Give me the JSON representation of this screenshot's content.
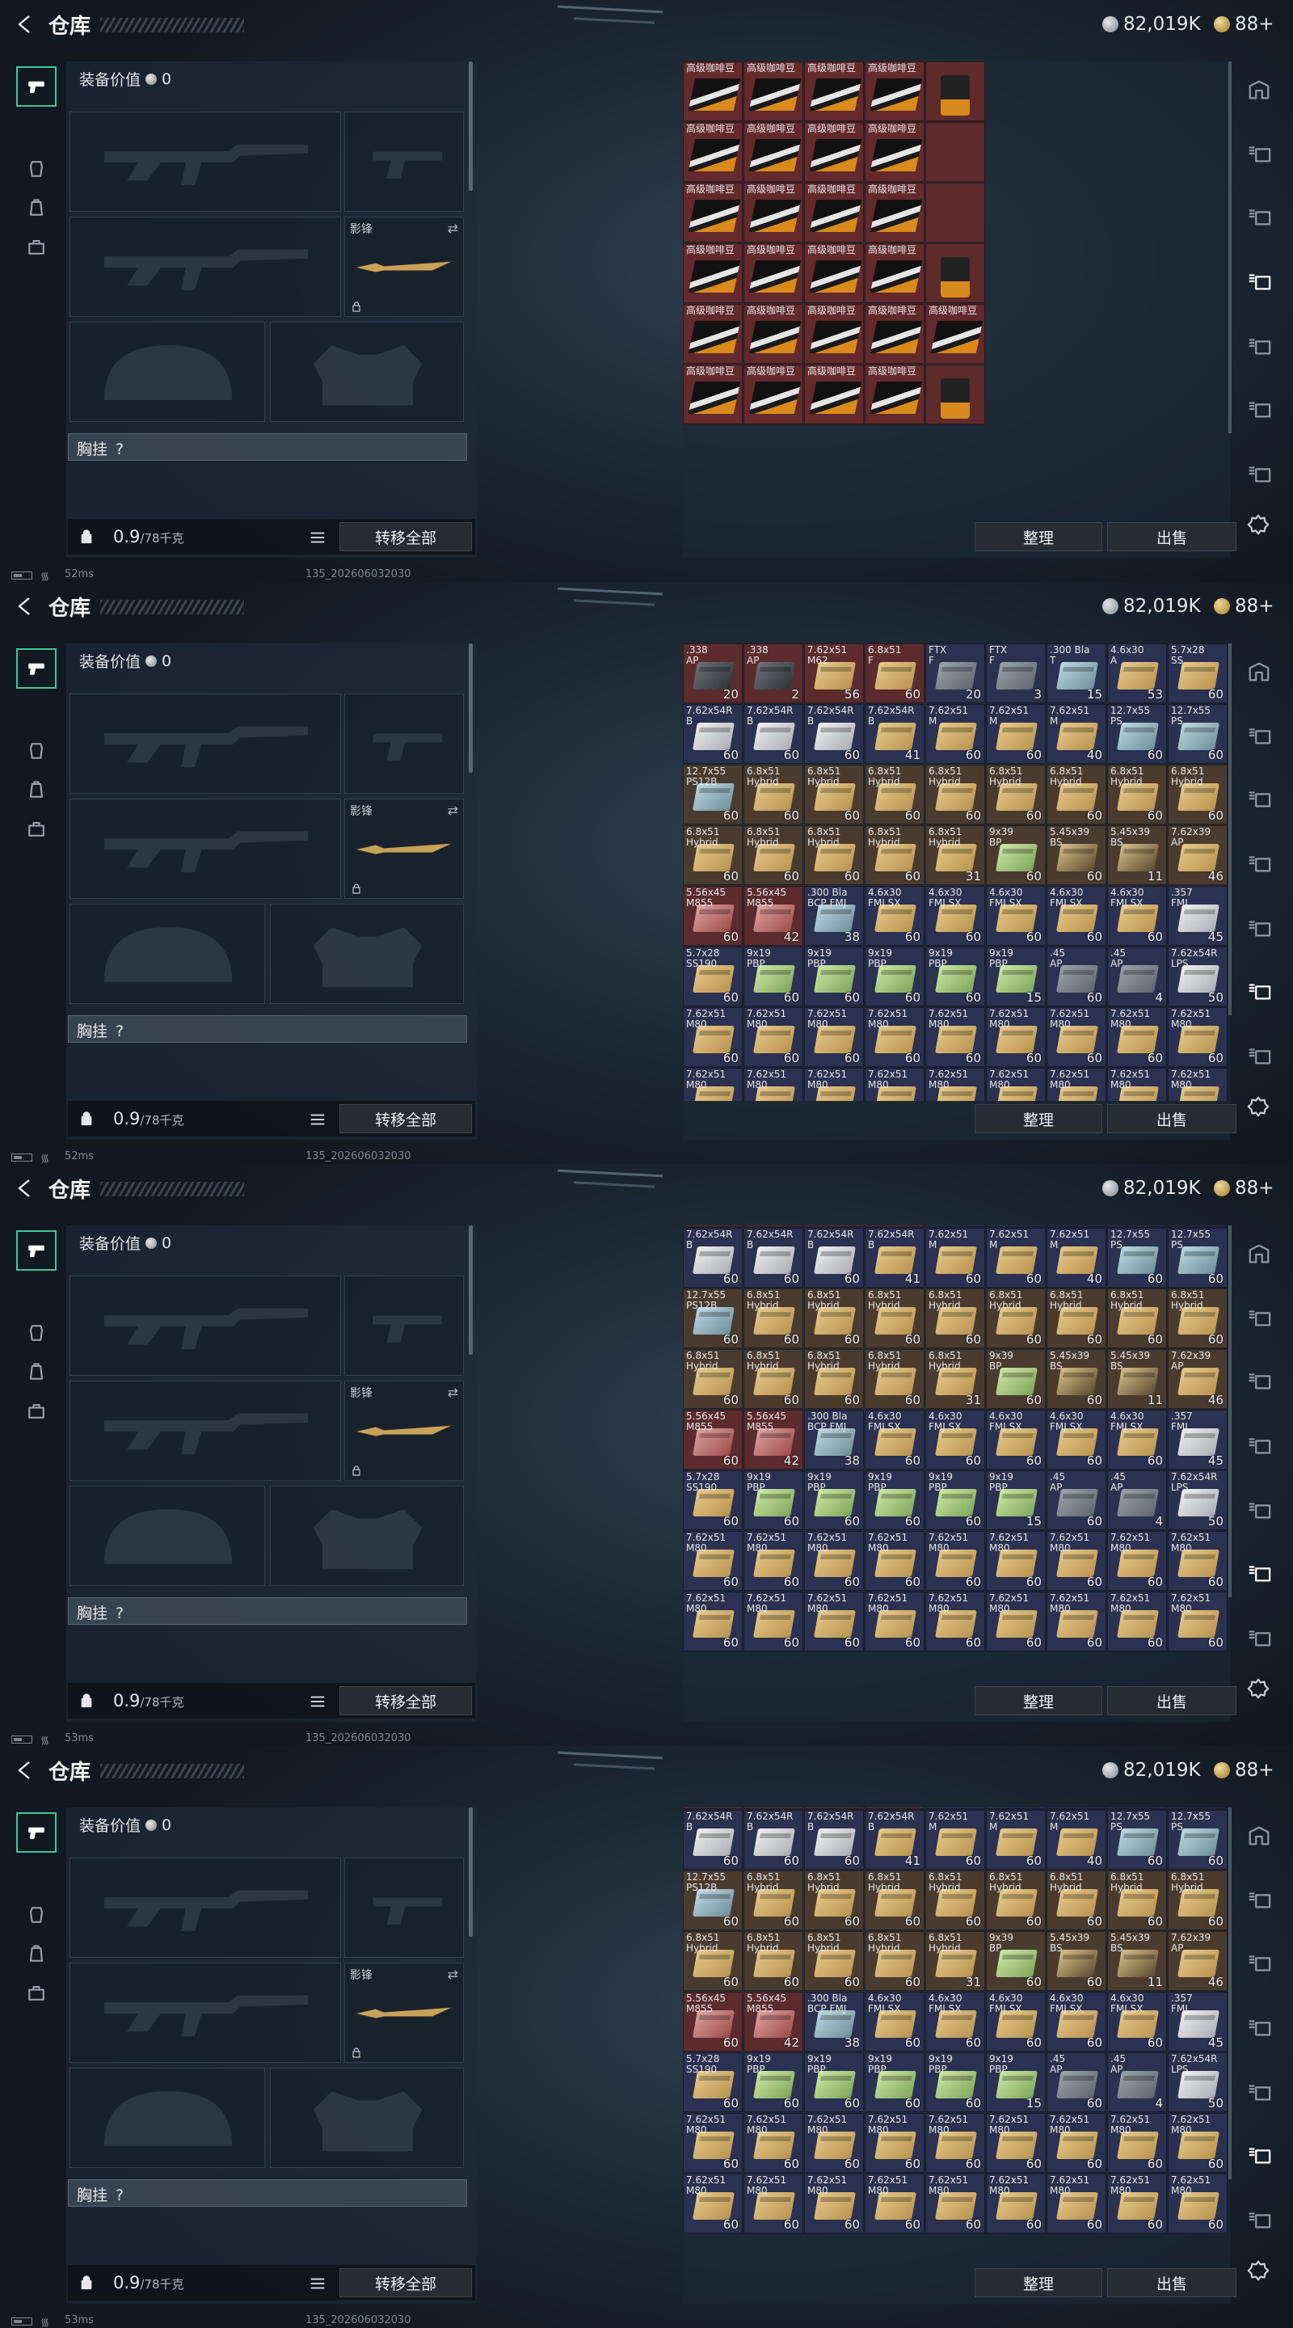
{
  "screens": [
    {
      "title": "仓库",
      "silver": "82,019K",
      "gold": "88+",
      "equip_value_label": "装备价值",
      "equip_value": "0",
      "knife_name": "影锋",
      "chest_label": "胸挂",
      "chest_help": "?",
      "weight_value": "0.9",
      "weight_max": "/78千克",
      "transfer_label": "转移全部",
      "sort_label": "整理",
      "sell_label": "出售",
      "ping": "52ms",
      "build": "135_202606032030",
      "view": "coffee"
    },
    {
      "title": "仓库",
      "silver": "82,019K",
      "gold": "88+",
      "equip_value_label": "装备价值",
      "equip_value": "0",
      "knife_name": "影锋",
      "chest_label": "胸挂",
      "chest_help": "?",
      "weight_value": "0.9",
      "weight_max": "/78千克",
      "transfer_label": "转移全部",
      "sort_label": "整理",
      "sell_label": "出售",
      "ping": "52ms",
      "build": "135_202606032030",
      "view": "ammo",
      "scroll": 0
    },
    {
      "title": "仓库",
      "silver": "82,019K",
      "gold": "88+",
      "equip_value_label": "装备价值",
      "equip_value": "0",
      "knife_name": "影锋",
      "chest_label": "胸挂",
      "chest_help": "?",
      "weight_value": "0.9",
      "weight_max": "/78千克",
      "transfer_label": "转移全部",
      "sort_label": "整理",
      "sell_label": "出售",
      "ping": "53ms",
      "build": "135_202606032030",
      "view": "ammo",
      "scroll": 1
    },
    {
      "title": "仓库",
      "silver": "82,019K",
      "gold": "88+",
      "equip_value_label": "装备价值",
      "equip_value": "0",
      "knife_name": "影锋",
      "chest_label": "胸挂",
      "chest_help": "?",
      "weight_value": "0.9",
      "weight_max": "/78千克",
      "transfer_label": "转移全部",
      "sort_label": "整理",
      "sell_label": "出售",
      "ping": "53ms",
      "build": "135_202606032030",
      "view": "ammo",
      "scroll": 2
    }
  ],
  "coffee_grid": {
    "item_label": "高级咖啡豆",
    "rows": [
      [
        "高级咖啡豆",
        "高级咖啡豆",
        "高级咖啡豆",
        "高级咖啡豆",
        "bag"
      ],
      [
        "高级咖啡豆",
        "高级咖啡豆",
        "高级咖啡豆",
        "高级咖啡豆",
        "bag"
      ],
      [
        "高级咖啡豆",
        "高级咖啡豆",
        "高级咖啡豆",
        "高级咖啡豆",
        "bag"
      ],
      [
        "高级咖啡豆",
        "高级咖啡豆",
        "高级咖啡豆",
        "高级咖啡豆",
        "bag"
      ],
      [
        "高级咖啡豆",
        "高级咖啡豆",
        "高级咖啡豆",
        "高级咖啡豆",
        "高级咖啡豆"
      ],
      [
        "高级咖啡豆",
        "高级咖啡豆",
        "高级咖啡豆",
        "高级咖啡豆",
        "bag"
      ]
    ]
  },
  "ammo_rows": [
    [
      [
        ".338\nAP",
        "20",
        "dark",
        "red"
      ],
      [
        ".338\nAP",
        "2",
        "dark",
        "red"
      ],
      [
        "7.62x51\nM62",
        "56",
        "tan",
        "red"
      ],
      [
        "6.8x51\nF",
        "60",
        "tan",
        "red"
      ],
      [
        "FTX\nF",
        "20",
        "grey",
        "navy"
      ],
      [
        "FTX\nF",
        "3",
        "grey",
        "navy"
      ],
      [
        ".300 Bla\nT",
        "15",
        "blue",
        "navy"
      ],
      [
        "4.6x30\nA",
        "53",
        "tan",
        "navy"
      ],
      [
        "5.7x28\nSS",
        "60",
        "tan",
        "navy"
      ]
    ],
    [
      [
        "7.62x54R\nB",
        "60",
        "white",
        "navy"
      ],
      [
        "7.62x54R\nB",
        "60",
        "white",
        "navy"
      ],
      [
        "7.62x54R\nB",
        "60",
        "white",
        "navy"
      ],
      [
        "7.62x54R\nB",
        "41",
        "tan",
        "navy"
      ],
      [
        "7.62x51\nM",
        "60",
        "tan",
        "navy"
      ],
      [
        "7.62x51\nM",
        "60",
        "tan",
        "navy"
      ],
      [
        "7.62x51\nM",
        "40",
        "tan",
        "navy"
      ],
      [
        "12.7x55\nPS",
        "60",
        "blue",
        "navy"
      ],
      [
        "12.7x55\nPS",
        "60",
        "blue",
        "navy"
      ]
    ],
    [
      [
        "12.7x55\nPS12B",
        "60",
        "blue",
        "brown"
      ],
      [
        "6.8x51\nHybrid",
        "60",
        "tan",
        "brown"
      ],
      [
        "6.8x51\nHybrid",
        "60",
        "tan",
        "brown"
      ],
      [
        "6.8x51\nHybrid",
        "60",
        "tan",
        "brown"
      ],
      [
        "6.8x51\nHybrid",
        "60",
        "tan",
        "brown"
      ],
      [
        "6.8x51\nHybrid",
        "60",
        "tan",
        "brown"
      ],
      [
        "6.8x51\nHybrid",
        "60",
        "tan",
        "brown"
      ],
      [
        "6.8x51\nHybrid",
        "60",
        "tan",
        "brown"
      ],
      [
        "6.8x51\nHybrid",
        "60",
        "tan",
        "brown"
      ]
    ],
    [
      [
        "6.8x51\nHybrid",
        "60",
        "tan",
        "brown"
      ],
      [
        "6.8x51\nHybrid",
        "60",
        "tan",
        "brown"
      ],
      [
        "6.8x51\nHybrid",
        "60",
        "tan",
        "brown"
      ],
      [
        "6.8x51\nHybrid",
        "60",
        "tan",
        "brown"
      ],
      [
        "6.8x51\nHybrid",
        "31",
        "tan",
        "brown"
      ],
      [
        "9x39\nBP",
        "60",
        "green",
        "brown"
      ],
      [
        "5.45x39\nBS",
        "60",
        "rod",
        "brown"
      ],
      [
        "5.45x39\nBS",
        "11",
        "rod",
        "brown"
      ],
      [
        "7.62x39\nAP",
        "46",
        "tan",
        "brown"
      ]
    ],
    [
      [
        "5.56x45\nM855",
        "60",
        "red",
        "red"
      ],
      [
        "5.56x45\nM855",
        "42",
        "red",
        "red"
      ],
      [
        ".300 Bla\nBCP FMJ",
        "38",
        "blue",
        "navy"
      ],
      [
        "4.6x30\nFMJ SX",
        "60",
        "tan",
        "navy"
      ],
      [
        "4.6x30\nFMJ SX",
        "60",
        "tan",
        "navy"
      ],
      [
        "4.6x30\nFMJ SX",
        "60",
        "tan",
        "navy"
      ],
      [
        "4.6x30\nFMJ SX",
        "60",
        "tan",
        "navy"
      ],
      [
        "4.6x30\nFMJ SX",
        "60",
        "tan",
        "navy"
      ],
      [
        ".357\nFMJ",
        "45",
        "white",
        "navy"
      ]
    ],
    [
      [
        "5.7x28\nSS190",
        "60",
        "tan",
        "navy"
      ],
      [
        "9x19\nPBP",
        "60",
        "green",
        "navy"
      ],
      [
        "9x19\nPBP",
        "60",
        "green",
        "navy"
      ],
      [
        "9x19\nPBP",
        "60",
        "green",
        "navy"
      ],
      [
        "9x19\nPBP",
        "60",
        "green",
        "navy"
      ],
      [
        "9x19\nPBP",
        "15",
        "green",
        "navy"
      ],
      [
        ".45\nAP",
        "60",
        "grey",
        "navy"
      ],
      [
        ".45\nAP",
        "4",
        "grey",
        "navy"
      ],
      [
        "7.62x54R\nLPS",
        "50",
        "white",
        "navy"
      ]
    ],
    [
      [
        "7.62x51\nM80",
        "60",
        "tan",
        "navy"
      ],
      [
        "7.62x51\nM80",
        "60",
        "tan",
        "navy"
      ],
      [
        "7.62x51\nM80",
        "60",
        "tan",
        "navy"
      ],
      [
        "7.62x51\nM80",
        "60",
        "tan",
        "navy"
      ],
      [
        "7.62x51\nM80",
        "60",
        "tan",
        "navy"
      ],
      [
        "7.62x51\nM80",
        "60",
        "tan",
        "navy"
      ],
      [
        "7.62x51\nM80",
        "60",
        "tan",
        "navy"
      ],
      [
        "7.62x51\nM80",
        "60",
        "tan",
        "navy"
      ],
      [
        "7.62x51\nM80",
        "60",
        "tan",
        "navy"
      ]
    ],
    [
      [
        "7.62x51\nM80",
        "60",
        "tan",
        "navy"
      ],
      [
        "7.62x51\nM80",
        "60",
        "tan",
        "navy"
      ],
      [
        "7.62x51\nM80",
        "60",
        "tan",
        "navy"
      ],
      [
        "7.62x51\nM80",
        "60",
        "tan",
        "navy"
      ],
      [
        "7.62x51\nM80",
        "60",
        "tan",
        "navy"
      ],
      [
        "7.62x51\nM80",
        "60",
        "tan",
        "navy"
      ],
      [
        "7.62x51\nM80",
        "60",
        "tan",
        "navy"
      ],
      [
        "7.62x51\nM80",
        "60",
        "tan",
        "navy"
      ],
      [
        "7.62x51\nM80",
        "60",
        "tan",
        "navy"
      ]
    ]
  ],
  "colors": {
    "accent_green": "#3cc79a",
    "panel": "#1e2a36",
    "button": "#252c33"
  },
  "icons": {
    "back": "back-arrow-icon",
    "silver": "silver-coin-icon",
    "gold": "gold-coin-icon",
    "settings": "gear-icon",
    "lock": "lock-icon",
    "list": "list-icon"
  }
}
